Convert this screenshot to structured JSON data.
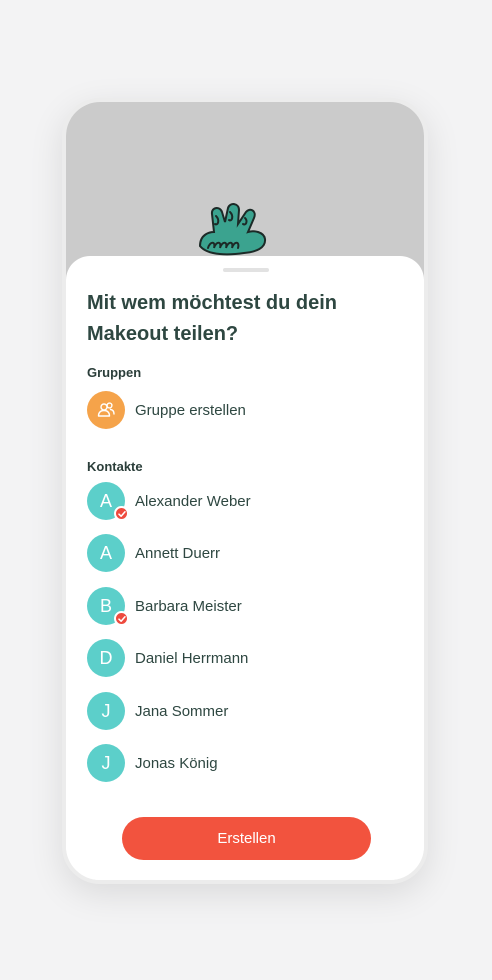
{
  "sheet": {
    "title": "Mit wem möchtest du dein Makeout teilen?"
  },
  "groups": {
    "label": "Gruppen",
    "create_label": "Gruppe erstellen",
    "create_icon": "people-icon"
  },
  "contacts": {
    "label": "Kontakte",
    "items": [
      {
        "initial": "A",
        "name": "Alexander Weber",
        "selected": true
      },
      {
        "initial": "A",
        "name": "Annett Duerr",
        "selected": false
      },
      {
        "initial": "B",
        "name": "Barbara Meister",
        "selected": true
      },
      {
        "initial": "D",
        "name": "Daniel Herrmann",
        "selected": false
      },
      {
        "initial": "J",
        "name": "Jana Sommer",
        "selected": false
      },
      {
        "initial": "J",
        "name": "Jonas König",
        "selected": false
      }
    ]
  },
  "action": {
    "create_label": "Erstellen"
  },
  "colors": {
    "avatar": "#5ccfca",
    "group_avatar": "#f5a34a",
    "accent": "#f2533e",
    "check": "#ee4a3e",
    "backdrop": "#cbcbcb",
    "mascot": "#3ba38f"
  }
}
